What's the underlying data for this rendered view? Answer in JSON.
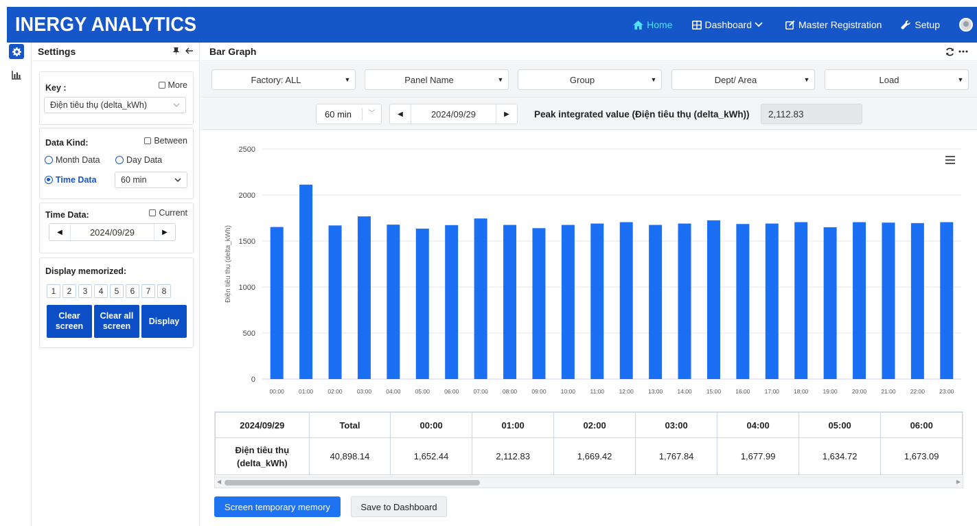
{
  "header": {
    "brand": "INERGY ANALYTICS",
    "nav": {
      "home": "Home",
      "dashboard": "Dashboard",
      "master_registration": "Master Registration",
      "setup": "Setup"
    },
    "colors": {
      "bar": "#1556c9",
      "active_nav": "#4fe3ff"
    }
  },
  "sidebar_icons": [
    "gear-icon",
    "bar-chart-icon"
  ],
  "settings": {
    "title": "Settings",
    "key": {
      "label": "Key :",
      "more_label": "More",
      "selected": "Điện tiêu thụ (delta_kWh)"
    },
    "data_kind": {
      "label": "Data Kind:",
      "between_label": "Between",
      "month_label": "Month Data",
      "day_label": "Day Data",
      "time_label": "Time Data",
      "selected": "Time Data",
      "interval": "60 min"
    },
    "time_data": {
      "label": "Time Data:",
      "current_label": "Current",
      "date": "2024/09/29"
    },
    "memory": {
      "label": "Display memorized:",
      "slots": [
        "1",
        "2",
        "3",
        "4",
        "5",
        "6",
        "7",
        "8"
      ],
      "clear_screen": "Clear screen",
      "clear_all_screen": "Clear all screen",
      "display": "Display"
    }
  },
  "main": {
    "title": "Bar Graph",
    "filters": {
      "factory": "Factory: ALL",
      "panel": "Panel Name",
      "group": "Group",
      "dept": "Dept/ Area",
      "load": "Load"
    },
    "controls": {
      "interval": "60 min",
      "date": "2024/09/29",
      "peak_label": "Peak integrated value (Điện tiêu thụ (delta_kWh))",
      "peak_value": "2,112.83"
    },
    "table": {
      "header_date": "2024/09/29",
      "header_total": "Total",
      "hours": [
        "00:00",
        "01:00",
        "02:00",
        "03:00",
        "04:00",
        "05:00",
        "06:00"
      ],
      "row_label_1": "Điện tiêu thụ",
      "row_label_2": "(delta_kWh)",
      "total": "40,898.14",
      "values": [
        "1,652.44",
        "2,112.83",
        "1,669.42",
        "1,767.84",
        "1,677.99",
        "1,634.72",
        "1,673.09"
      ]
    },
    "buttons": {
      "temp_memory": "Screen temporary memory",
      "save_dashboard": "Save to Dashboard"
    }
  },
  "chart_data": {
    "type": "bar",
    "categories": [
      "00:00",
      "01:00",
      "02:00",
      "03:00",
      "04:00",
      "05:00",
      "06:00",
      "07:00",
      "08:00",
      "09:00",
      "10:00",
      "11:00",
      "12:00",
      "13:00",
      "14:00",
      "15:00",
      "16:00",
      "17:00",
      "18:00",
      "19:00",
      "20:00",
      "21:00",
      "22:00",
      "23:00"
    ],
    "values": [
      1652.44,
      2112.83,
      1669.42,
      1767.84,
      1677.99,
      1634.72,
      1673.09,
      1745,
      1675,
      1640,
      1675,
      1690,
      1705,
      1675,
      1690,
      1725,
      1685,
      1690,
      1705,
      1650,
      1705,
      1700,
      1695,
      1705
    ],
    "ylabel": "Điện tiêu thụ (delta_kWh)",
    "yticks": [
      "0",
      "500",
      "1000",
      "1500",
      "2000",
      "2500"
    ],
    "ylim": [
      0,
      2500
    ],
    "grid": true,
    "color": "#1a6ff2"
  }
}
